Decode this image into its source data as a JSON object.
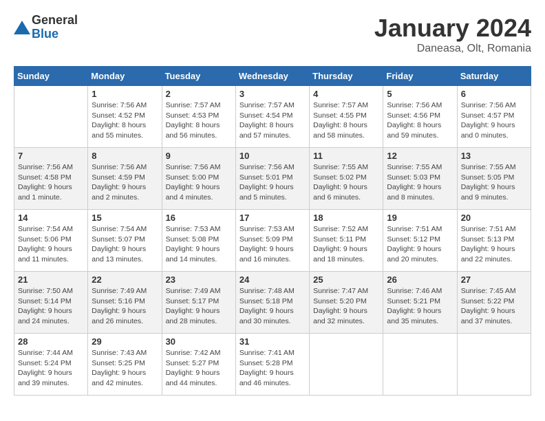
{
  "header": {
    "logo_general": "General",
    "logo_blue": "Blue",
    "month_title": "January 2024",
    "location": "Daneasa, Olt, Romania"
  },
  "days_of_week": [
    "Sunday",
    "Monday",
    "Tuesday",
    "Wednesday",
    "Thursday",
    "Friday",
    "Saturday"
  ],
  "weeks": [
    [
      {
        "day": "",
        "info": ""
      },
      {
        "day": "1",
        "info": "Sunrise: 7:56 AM\nSunset: 4:52 PM\nDaylight: 8 hours\nand 55 minutes."
      },
      {
        "day": "2",
        "info": "Sunrise: 7:57 AM\nSunset: 4:53 PM\nDaylight: 8 hours\nand 56 minutes."
      },
      {
        "day": "3",
        "info": "Sunrise: 7:57 AM\nSunset: 4:54 PM\nDaylight: 8 hours\nand 57 minutes."
      },
      {
        "day": "4",
        "info": "Sunrise: 7:57 AM\nSunset: 4:55 PM\nDaylight: 8 hours\nand 58 minutes."
      },
      {
        "day": "5",
        "info": "Sunrise: 7:56 AM\nSunset: 4:56 PM\nDaylight: 8 hours\nand 59 minutes."
      },
      {
        "day": "6",
        "info": "Sunrise: 7:56 AM\nSunset: 4:57 PM\nDaylight: 9 hours\nand 0 minutes."
      }
    ],
    [
      {
        "day": "7",
        "info": "Sunrise: 7:56 AM\nSunset: 4:58 PM\nDaylight: 9 hours\nand 1 minute."
      },
      {
        "day": "8",
        "info": "Sunrise: 7:56 AM\nSunset: 4:59 PM\nDaylight: 9 hours\nand 2 minutes."
      },
      {
        "day": "9",
        "info": "Sunrise: 7:56 AM\nSunset: 5:00 PM\nDaylight: 9 hours\nand 4 minutes."
      },
      {
        "day": "10",
        "info": "Sunrise: 7:56 AM\nSunset: 5:01 PM\nDaylight: 9 hours\nand 5 minutes."
      },
      {
        "day": "11",
        "info": "Sunrise: 7:55 AM\nSunset: 5:02 PM\nDaylight: 9 hours\nand 6 minutes."
      },
      {
        "day": "12",
        "info": "Sunrise: 7:55 AM\nSunset: 5:03 PM\nDaylight: 9 hours\nand 8 minutes."
      },
      {
        "day": "13",
        "info": "Sunrise: 7:55 AM\nSunset: 5:05 PM\nDaylight: 9 hours\nand 9 minutes."
      }
    ],
    [
      {
        "day": "14",
        "info": "Sunrise: 7:54 AM\nSunset: 5:06 PM\nDaylight: 9 hours\nand 11 minutes."
      },
      {
        "day": "15",
        "info": "Sunrise: 7:54 AM\nSunset: 5:07 PM\nDaylight: 9 hours\nand 13 minutes."
      },
      {
        "day": "16",
        "info": "Sunrise: 7:53 AM\nSunset: 5:08 PM\nDaylight: 9 hours\nand 14 minutes."
      },
      {
        "day": "17",
        "info": "Sunrise: 7:53 AM\nSunset: 5:09 PM\nDaylight: 9 hours\nand 16 minutes."
      },
      {
        "day": "18",
        "info": "Sunrise: 7:52 AM\nSunset: 5:11 PM\nDaylight: 9 hours\nand 18 minutes."
      },
      {
        "day": "19",
        "info": "Sunrise: 7:51 AM\nSunset: 5:12 PM\nDaylight: 9 hours\nand 20 minutes."
      },
      {
        "day": "20",
        "info": "Sunrise: 7:51 AM\nSunset: 5:13 PM\nDaylight: 9 hours\nand 22 minutes."
      }
    ],
    [
      {
        "day": "21",
        "info": "Sunrise: 7:50 AM\nSunset: 5:14 PM\nDaylight: 9 hours\nand 24 minutes."
      },
      {
        "day": "22",
        "info": "Sunrise: 7:49 AM\nSunset: 5:16 PM\nDaylight: 9 hours\nand 26 minutes."
      },
      {
        "day": "23",
        "info": "Sunrise: 7:49 AM\nSunset: 5:17 PM\nDaylight: 9 hours\nand 28 minutes."
      },
      {
        "day": "24",
        "info": "Sunrise: 7:48 AM\nSunset: 5:18 PM\nDaylight: 9 hours\nand 30 minutes."
      },
      {
        "day": "25",
        "info": "Sunrise: 7:47 AM\nSunset: 5:20 PM\nDaylight: 9 hours\nand 32 minutes."
      },
      {
        "day": "26",
        "info": "Sunrise: 7:46 AM\nSunset: 5:21 PM\nDaylight: 9 hours\nand 35 minutes."
      },
      {
        "day": "27",
        "info": "Sunrise: 7:45 AM\nSunset: 5:22 PM\nDaylight: 9 hours\nand 37 minutes."
      }
    ],
    [
      {
        "day": "28",
        "info": "Sunrise: 7:44 AM\nSunset: 5:24 PM\nDaylight: 9 hours\nand 39 minutes."
      },
      {
        "day": "29",
        "info": "Sunrise: 7:43 AM\nSunset: 5:25 PM\nDaylight: 9 hours\nand 42 minutes."
      },
      {
        "day": "30",
        "info": "Sunrise: 7:42 AM\nSunset: 5:27 PM\nDaylight: 9 hours\nand 44 minutes."
      },
      {
        "day": "31",
        "info": "Sunrise: 7:41 AM\nSunset: 5:28 PM\nDaylight: 9 hours\nand 46 minutes."
      },
      {
        "day": "",
        "info": ""
      },
      {
        "day": "",
        "info": ""
      },
      {
        "day": "",
        "info": ""
      }
    ]
  ]
}
